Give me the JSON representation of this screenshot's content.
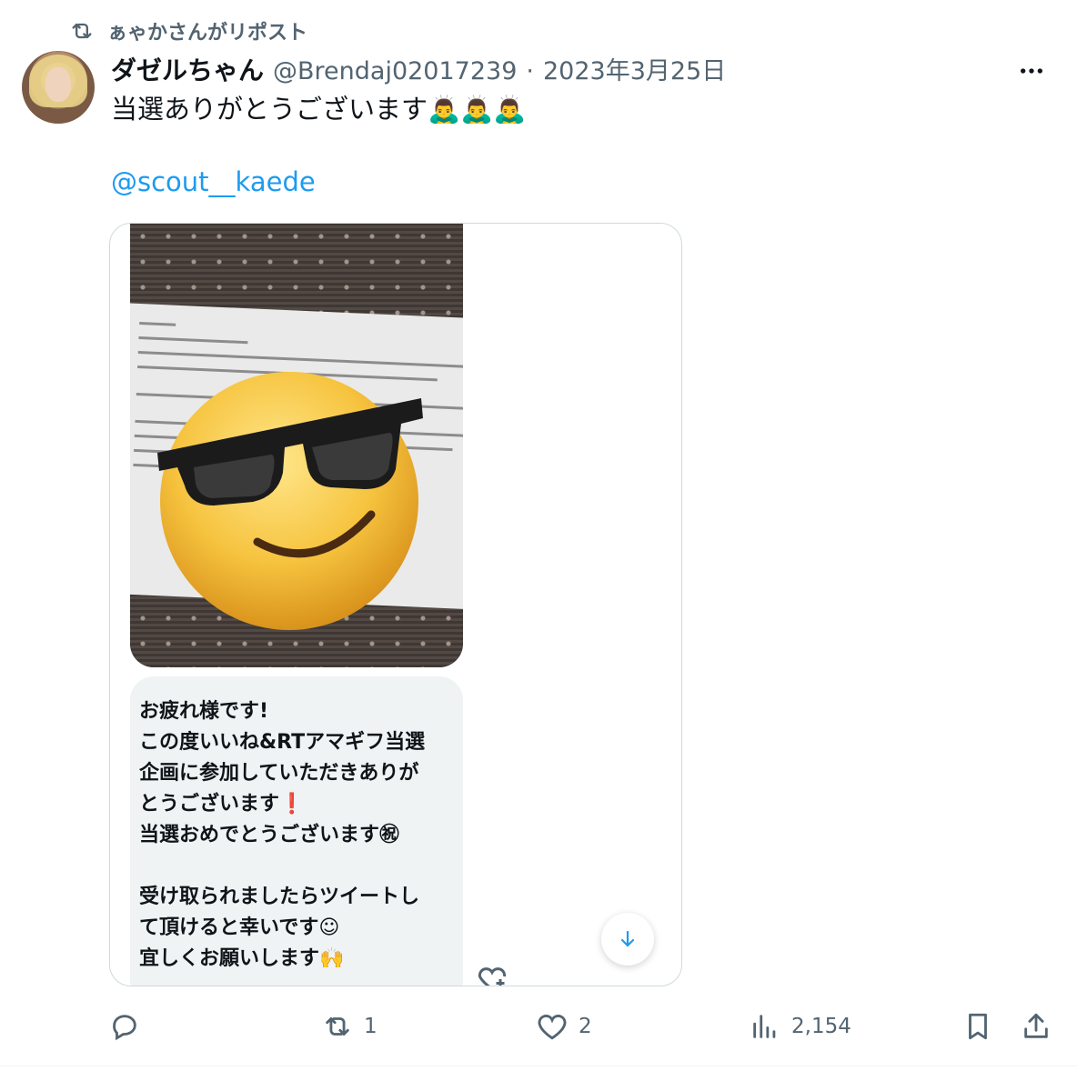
{
  "repost": {
    "label": "ぁゃかさんがリポスト",
    "icon": "repost-icon"
  },
  "tweet": {
    "display_name": "ダゼルちゃん",
    "handle": "@Brendaj02017239",
    "separator": "·",
    "date": "2023年3月25日",
    "text": "当選ありがとうございます🙇‍♂️🙇‍♂️🙇‍♂️",
    "mention": "@scout__kaede"
  },
  "dm_screenshot": {
    "lines": [
      "お疲れ様です!",
      "この度いいね&RTアマギフ当選",
      "企画に参加していただきありが",
      "とうございます❗",
      "当選おめでとうございます㊗",
      "",
      "受け取られましたらツイートし",
      "て頂けると幸いです☺",
      "宜しくお願いします🙌"
    ]
  },
  "actions": {
    "reply": {
      "icon": "reply-icon",
      "count": ""
    },
    "repost": {
      "icon": "repost-icon",
      "count": "1"
    },
    "like": {
      "icon": "heart-icon",
      "count": "2"
    },
    "views": {
      "icon": "views-icon",
      "count": "2,154"
    },
    "bookmark": {
      "icon": "bookmark-icon"
    },
    "share": {
      "icon": "share-icon"
    }
  },
  "colors": {
    "text": "#0f1419",
    "secondary": "#536471",
    "link": "#1d9bf0",
    "border": "#cfd9de"
  }
}
